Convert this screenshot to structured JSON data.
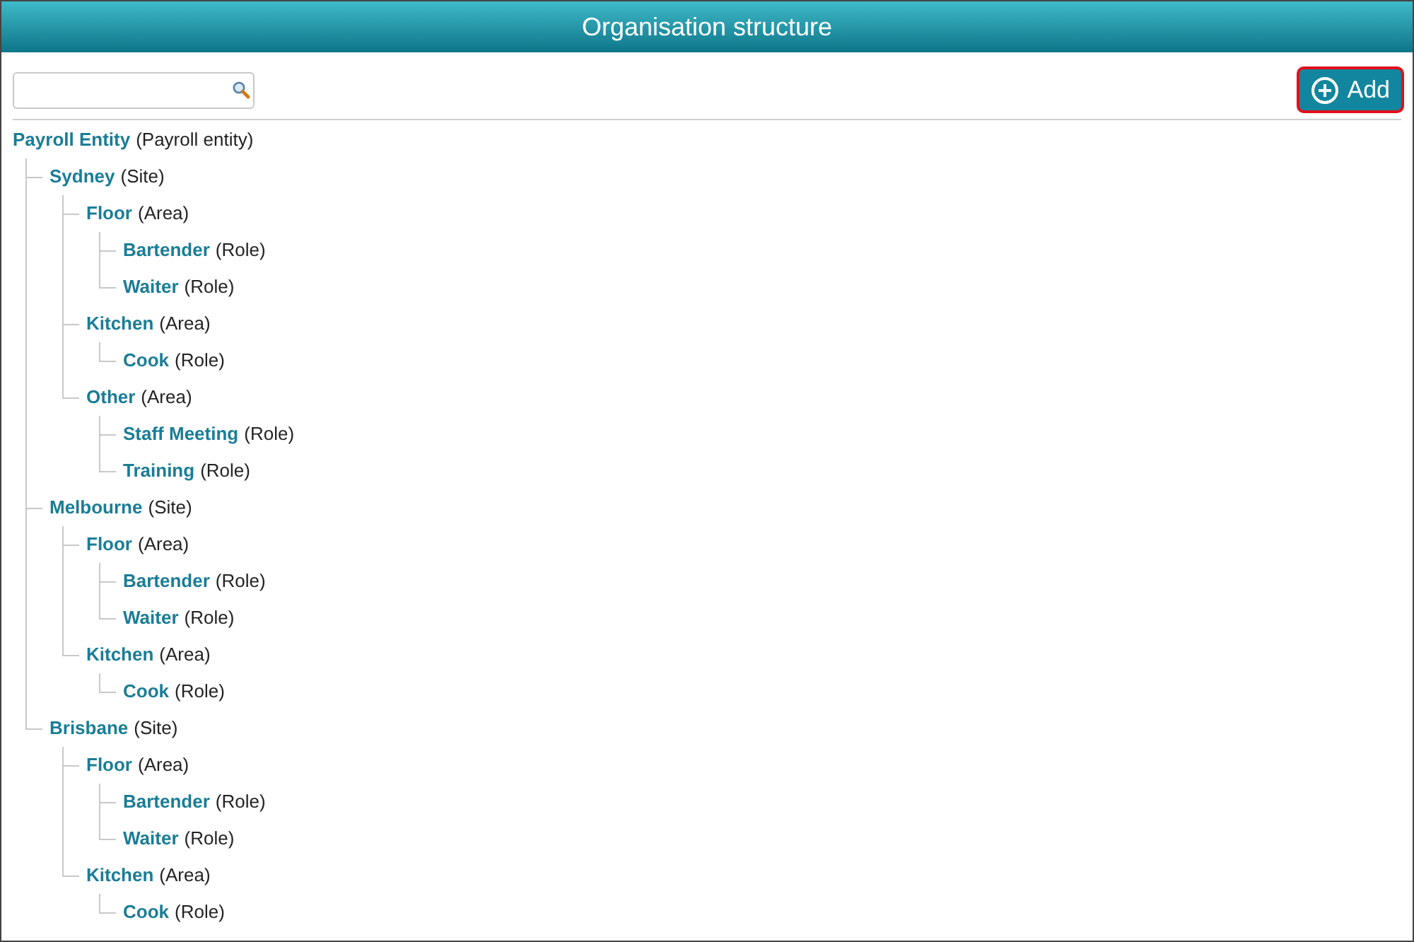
{
  "window": {
    "title": "Organisation structure"
  },
  "toolbar": {
    "add_button": {
      "label": "Add"
    }
  },
  "tree": [
    {
      "name": "Payroll Entity",
      "type": "(Payroll entity)",
      "children": [
        {
          "name": "Sydney",
          "type": "(Site)",
          "children": [
            {
              "name": "Floor",
              "type": "(Area)",
              "children": [
                {
                  "name": "Bartender",
                  "type": "(Role)"
                },
                {
                  "name": "Waiter",
                  "type": "(Role)"
                }
              ]
            },
            {
              "name": "Kitchen",
              "type": "(Area)",
              "children": [
                {
                  "name": "Cook",
                  "type": "(Role)"
                }
              ]
            },
            {
              "name": "Other",
              "type": "(Area)",
              "children": [
                {
                  "name": "Staff Meeting",
                  "type": "(Role)"
                },
                {
                  "name": "Training",
                  "type": "(Role)"
                }
              ]
            }
          ]
        },
        {
          "name": "Melbourne",
          "type": "(Site)",
          "children": [
            {
              "name": "Floor",
              "type": "(Area)",
              "children": [
                {
                  "name": "Bartender",
                  "type": "(Role)"
                },
                {
                  "name": "Waiter",
                  "type": "(Role)"
                }
              ]
            },
            {
              "name": "Kitchen",
              "type": "(Area)",
              "children": [
                {
                  "name": "Cook",
                  "type": "(Role)"
                }
              ]
            }
          ]
        },
        {
          "name": "Brisbane",
          "type": "(Site)",
          "children": [
            {
              "name": "Floor",
              "type": "(Area)",
              "children": [
                {
                  "name": "Bartender",
                  "type": "(Role)"
                },
                {
                  "name": "Waiter",
                  "type": "(Role)"
                }
              ]
            },
            {
              "name": "Kitchen",
              "type": "(Area)",
              "children": [
                {
                  "name": "Cook",
                  "type": "(Role)"
                }
              ]
            }
          ]
        }
      ]
    }
  ]
}
